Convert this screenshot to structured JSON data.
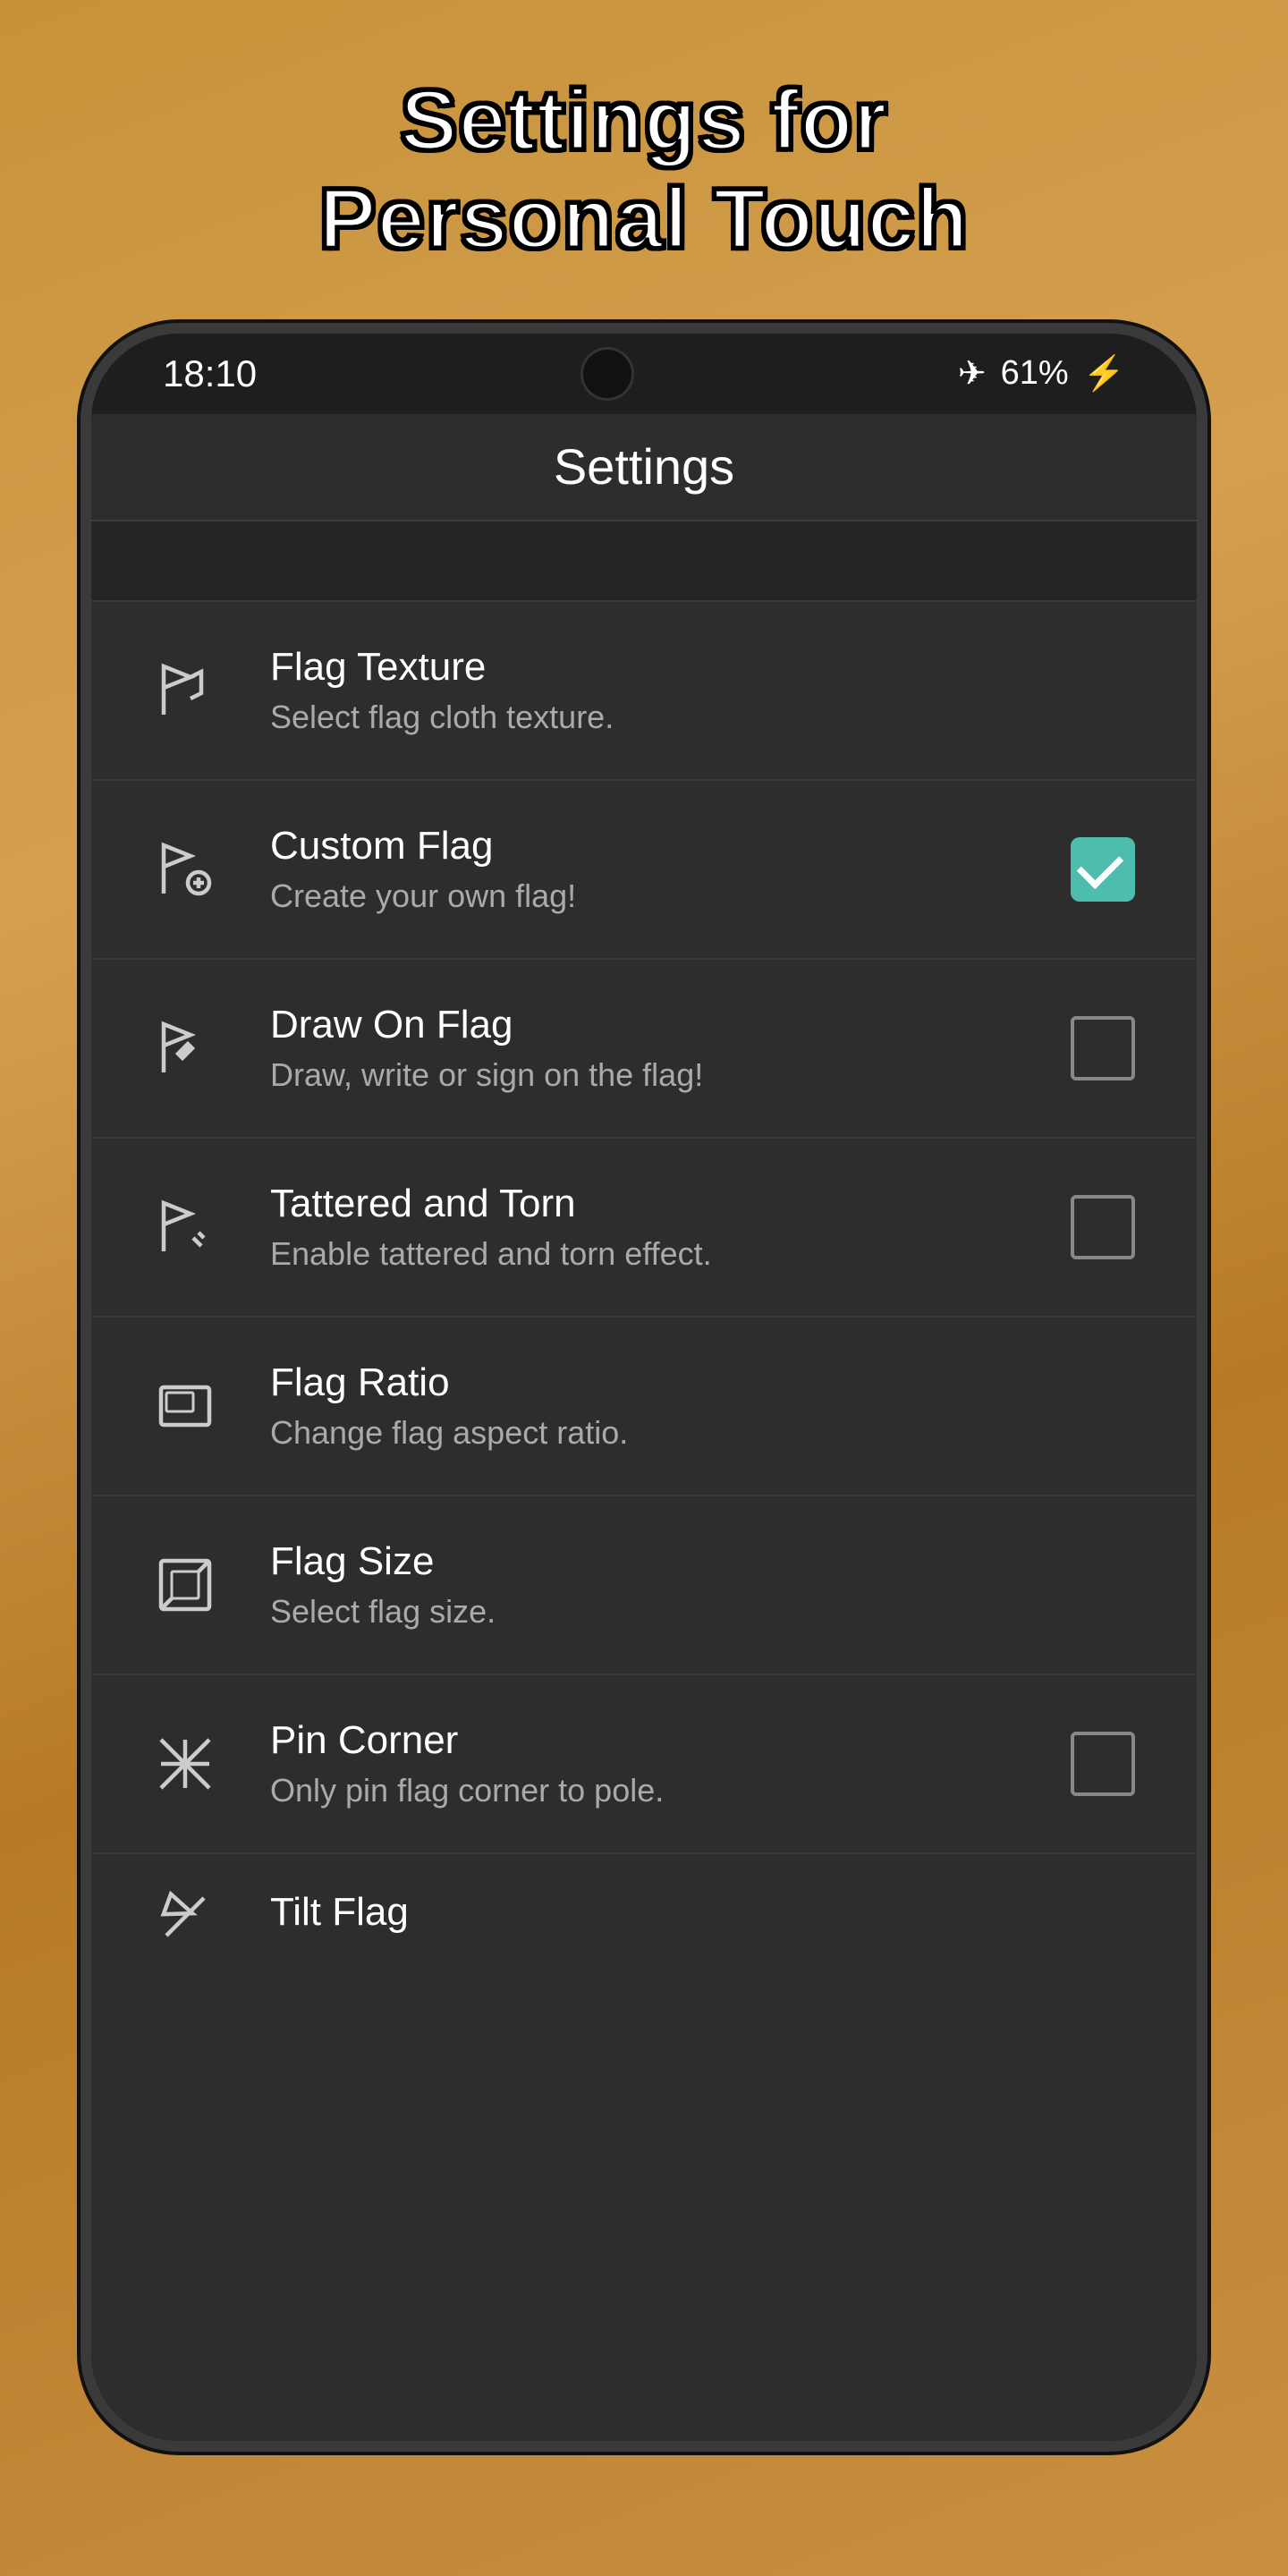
{
  "page": {
    "title_line1": "Settings for",
    "title_line2": "Personal Touch"
  },
  "status_bar": {
    "time": "18:10",
    "battery": "61%",
    "airplane_mode": true
  },
  "app_bar": {
    "title": "Settings"
  },
  "settings_items": [
    {
      "id": "flag-texture",
      "title": "Flag Texture",
      "subtitle": "Select flag cloth texture.",
      "icon": "flag-texture-icon",
      "control": "none"
    },
    {
      "id": "custom-flag",
      "title": "Custom Flag",
      "subtitle": "Create your own flag!",
      "icon": "custom-flag-icon",
      "control": "checkbox-checked"
    },
    {
      "id": "draw-on-flag",
      "title": "Draw On Flag",
      "subtitle": "Draw, write or sign on the flag!",
      "icon": "draw-flag-icon",
      "control": "checkbox-unchecked"
    },
    {
      "id": "tattered-torn",
      "title": "Tattered and Torn",
      "subtitle": "Enable tattered and torn effect.",
      "icon": "tattered-flag-icon",
      "control": "checkbox-unchecked"
    },
    {
      "id": "flag-ratio",
      "title": "Flag Ratio",
      "subtitle": "Change flag aspect ratio.",
      "icon": "ratio-icon",
      "control": "none"
    },
    {
      "id": "flag-size",
      "title": "Flag Size",
      "subtitle": "Select flag size.",
      "icon": "size-icon",
      "control": "none"
    },
    {
      "id": "pin-corner",
      "title": "Pin Corner",
      "subtitle": "Only pin flag corner to pole.",
      "icon": "pin-icon",
      "control": "checkbox-unchecked"
    },
    {
      "id": "tilt-flag",
      "title": "Tilt Flag",
      "subtitle": "",
      "icon": "tilt-icon",
      "control": "none"
    }
  ]
}
